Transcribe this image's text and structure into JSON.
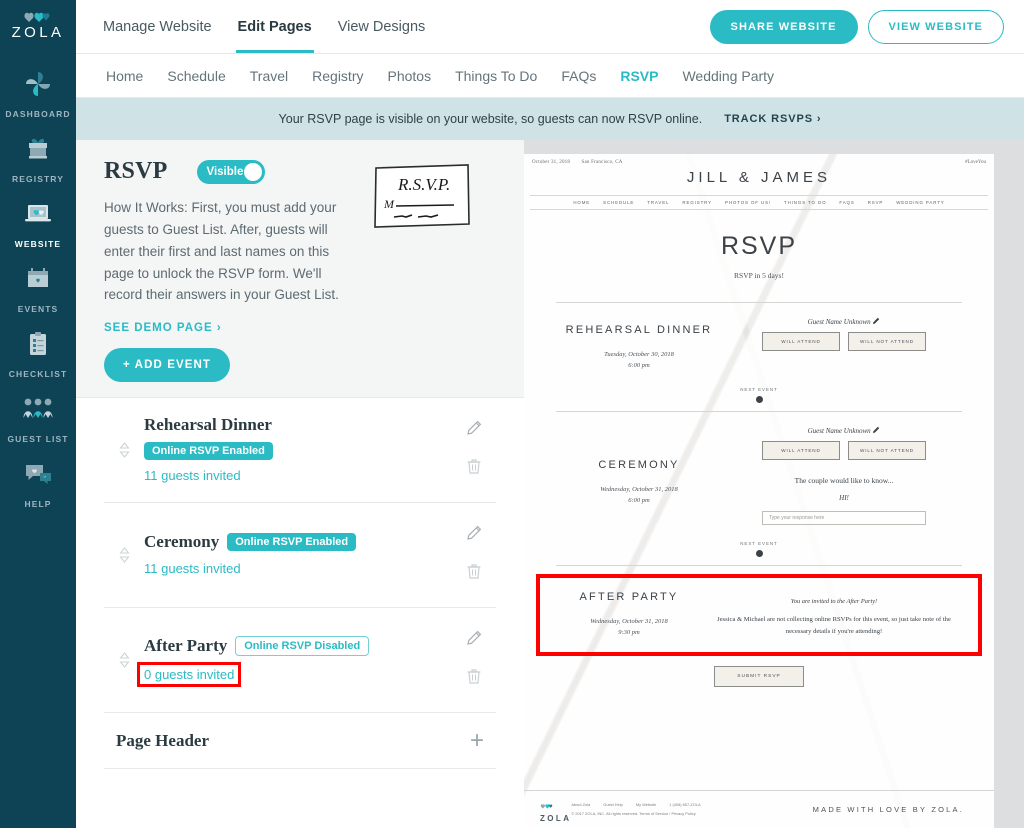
{
  "brand": {
    "name": "ZOLA",
    "logo_icon": "zola-hearts-logo"
  },
  "sidebar": {
    "items": [
      {
        "label": "DASHBOARD",
        "icon": "pinwheel-icon",
        "active": false
      },
      {
        "label": "REGISTRY",
        "icon": "gift-box-icon",
        "active": false
      },
      {
        "label": "WEBSITE",
        "icon": "laptop-icon",
        "active": true
      },
      {
        "label": "EVENTS",
        "icon": "calendar-icon",
        "active": false
      },
      {
        "label": "CHECKLIST",
        "icon": "clipboard-icon",
        "active": false
      },
      {
        "label": "GUEST LIST",
        "icon": "people-icon",
        "active": false
      },
      {
        "label": "HELP",
        "icon": "chat-bubbles-icon",
        "active": false
      }
    ]
  },
  "topnav": {
    "items": [
      {
        "label": "Manage Website",
        "active": false
      },
      {
        "label": "Edit Pages",
        "active": true
      },
      {
        "label": "View Designs",
        "active": false
      }
    ],
    "share_button": "SHARE WEBSITE",
    "view_button": "VIEW WEBSITE"
  },
  "subnav": {
    "items": [
      {
        "label": "Home",
        "active": false
      },
      {
        "label": "Schedule",
        "active": false
      },
      {
        "label": "Travel",
        "active": false
      },
      {
        "label": "Registry",
        "active": false
      },
      {
        "label": "Photos",
        "active": false
      },
      {
        "label": "Things To Do",
        "active": false
      },
      {
        "label": "FAQs",
        "active": false
      },
      {
        "label": "RSVP",
        "active": true
      },
      {
        "label": "Wedding Party",
        "active": false
      }
    ]
  },
  "banner": {
    "text": "Your RSVP page is visible on your website, so guests can now RSVP online.",
    "link": "TRACK RSVPS ›"
  },
  "rsvp_panel": {
    "title": "RSVP",
    "toggle_label": "Visible",
    "toggle_on": true,
    "description": "How It Works: First, you must add your guests to Guest List. After, guests will enter their first and last names on this page to unlock the RSVP form. We'll record their answers in your Guest List.",
    "demo_link": "SEE DEMO PAGE ›",
    "add_event_button": "+ ADD EVENT",
    "stamp_icon": "rsvp-card-illustration",
    "stamp_text": "R.S.V.P.",
    "stamp_line": "M"
  },
  "events": [
    {
      "name": "Rehearsal Dinner",
      "tag": "Online RSVP Enabled",
      "tag_state": "enabled",
      "guests": "11 guests invited",
      "inline_tag": false,
      "highlight": false
    },
    {
      "name": "Ceremony",
      "tag": "Online RSVP Enabled",
      "tag_state": "enabled",
      "guests": "11 guests invited",
      "inline_tag": true,
      "highlight": false
    },
    {
      "name": "After Party",
      "tag": "Online RSVP Disabled",
      "tag_state": "disabled",
      "guests": "0 guests invited",
      "inline_tag": true,
      "highlight": true
    }
  ],
  "row_icons": {
    "edit": "pencil-icon",
    "delete": "trash-icon",
    "reorder": "drag-handle-icon"
  },
  "page_header": {
    "title": "Page Header",
    "add_icon": "plus-icon"
  },
  "preview": {
    "date": "October 31, 2018",
    "location": "San Francisco, CA",
    "hashtag": "#LoveYou",
    "couple": "JILL & JAMES",
    "nav": [
      "HOME",
      "SCHEDULE",
      "TRAVEL",
      "REGISTRY",
      "PHOTOS OF US!",
      "THINGS TO DO",
      "FAQS",
      "RSVP",
      "WEDDING PARTY"
    ],
    "page_title": "RSVP",
    "countdown": "RSVP in 5 days!",
    "next_event_label": "NEXT EVENT",
    "guest_name_unknown": "Guest Name Unknown",
    "edit_pencil_icon": "pencil-icon",
    "will_attend": "WILL ATTEND",
    "will_not_attend": "WILL NOT ATTEND",
    "events": [
      {
        "title": "REHEARSAL DINNER",
        "date": "Tuesday, October 30, 2018",
        "time": "6:00 pm"
      },
      {
        "title": "CEREMONY",
        "date": "Wednesday, October 31, 2018",
        "time": "6:00 pm",
        "question_intro": "The couple would like to know...",
        "question": "HI!",
        "response_placeholder": "Type your response here"
      }
    ],
    "after_party": {
      "title": "AFTER PARTY",
      "date": "Wednesday, October 31, 2018",
      "time": "9:30 pm",
      "note": "You are invited to the After Party!",
      "body": "Jessica & Michael are not collecting online RSVPs for this event, so just take note of the necessary details if you're attending!"
    },
    "submit_button": "SUBMIT RSVP",
    "footer": {
      "brand": "ZOLA",
      "links": [
        "About Zola",
        "Guest Help",
        "My Website",
        "1 (408) 657-ZOLA"
      ],
      "copyright": "© 2017 ZOLA, INC. All rights reserved. Terms of Service / Privacy Policy",
      "tagline": "MADE WITH LOVE BY ZOLA."
    }
  },
  "colors": {
    "teal": "#2bbbc4",
    "sidebar": "#0d4355",
    "banner": "#cfe3e7",
    "highlight_red": "#ff0000"
  }
}
